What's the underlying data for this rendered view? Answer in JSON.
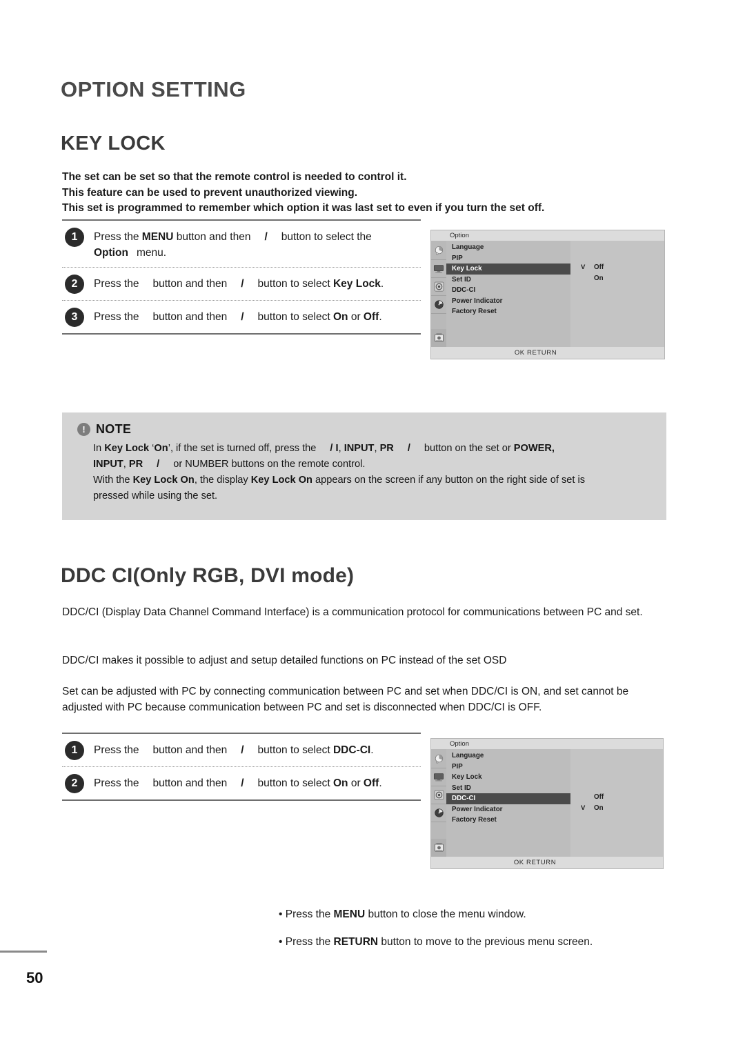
{
  "page": {
    "chapter_title": "OPTION SETTING",
    "page_number": "50"
  },
  "key_lock": {
    "section_title": "KEY LOCK",
    "intro_line1": "The set can be set so that the remote control is needed to control it.",
    "intro_line2": "This feature can be used to prevent unauthorized viewing.",
    "intro_line3": "This set is programmed to remember which option it was last set to even if you turn the set off.",
    "steps": [
      {
        "number": "1",
        "t1": "Press the ",
        "b1": "MENU",
        "t2": " button and then",
        "slash": "/",
        "t3": "button to select the",
        "b2": "Option",
        "t4": "menu."
      },
      {
        "number": "2",
        "t1": "Press the",
        "t2": "button and then",
        "slash": "/",
        "t3": "button to select ",
        "b1": "Key Lock",
        "t4": "."
      },
      {
        "number": "3",
        "t1": "Press the",
        "t2": "button and then",
        "slash": "/",
        "t3": "button to select ",
        "b1": "On",
        "t4": " or ",
        "b2": "Off",
        "t5": "."
      }
    ]
  },
  "osd_keylock": {
    "title": "Option",
    "items": [
      {
        "label": "Language",
        "selected": false
      },
      {
        "label": "PIP",
        "selected": false
      },
      {
        "label": "Key Lock",
        "selected": true
      },
      {
        "label": "Set ID",
        "selected": false
      },
      {
        "label": "DDC-CI",
        "selected": false
      },
      {
        "label": "Power Indicator",
        "selected": false
      },
      {
        "label": "Factory Reset",
        "selected": false
      }
    ],
    "options": [
      {
        "label": "Off",
        "checked": true
      },
      {
        "label": "On",
        "checked": false
      }
    ],
    "check_mark": "V",
    "footer": "OK  RETURN",
    "rail_icons": [
      "picture-icon",
      "screen-icon",
      "audio-icon",
      "time-icon",
      "option-icon"
    ]
  },
  "note": {
    "title": "NOTE",
    "icon": "exclamation-icon",
    "line1_a": "In ",
    "line1_b1": "Key Lock",
    "line1_c": " ‘",
    "line1_b2": "On",
    "line1_d": "’, if the set is turned off, press the",
    "line1_b3": "/ I",
    "line1_e": ", ",
    "line1_b4": "INPUT",
    "line1_f": ", ",
    "line1_b5": "PR",
    "line1_g": "/",
    "line1_h": "button on the set or ",
    "line1_b6": "POWER,",
    "line2_b1": "INPUT",
    "line2_a": ", ",
    "line2_b2": "PR",
    "line2_b": "/",
    "line2_c": "or NUMBER buttons on the remote control.",
    "line3_a": "With the ",
    "line3_b1": "Key Lock On",
    "line3_b": ", the display ",
    "line3_b2": "Key Lock On",
    "line3_c": " appears on the screen if any button on the right side of set is",
    "line4": "pressed while using the set."
  },
  "ddc": {
    "section_title": "DDC CI(Only RGB, DVI mode)",
    "para1": "DDC/CI (Display Data Channel Command Interface) is a communication protocol for communications between PC and set.",
    "para2": "DDC/CI makes it possible to adjust and setup detailed functions on PC instead of the set OSD",
    "para3": "Set can be adjusted with PC by connecting communication between PC and set when DDC/CI is ON, and set cannot be adjusted with PC because communication between PC and set is disconnected when DDC/CI is OFF.",
    "steps": [
      {
        "number": "1",
        "t1": "Press the",
        "t2": "button and then",
        "slash": "/",
        "t3": "button to select ",
        "b1": "DDC-CI",
        "t4": "."
      },
      {
        "number": "2",
        "t1": "Press the",
        "t2": "button and then",
        "slash": "/",
        "t3": "button to select ",
        "b1": "On",
        "t4": " or ",
        "b2": "Off",
        "t5": "."
      }
    ]
  },
  "osd_ddc": {
    "title": "Option",
    "items": [
      {
        "label": "Language",
        "selected": false
      },
      {
        "label": "PIP",
        "selected": false
      },
      {
        "label": "Key Lock",
        "selected": false
      },
      {
        "label": "Set ID",
        "selected": false
      },
      {
        "label": "DDC-CI",
        "selected": true
      },
      {
        "label": "Power Indicator",
        "selected": false
      },
      {
        "label": "Factory Reset",
        "selected": false
      }
    ],
    "options": [
      {
        "label": "Off",
        "checked": false
      },
      {
        "label": "On",
        "checked": true
      }
    ],
    "check_mark": "V",
    "footer": "OK  RETURN",
    "rail_icons": [
      "picture-icon",
      "screen-icon",
      "audio-icon",
      "time-icon",
      "option-icon"
    ]
  },
  "bottom_notes": [
    {
      "a": "• Press the ",
      "b": "MENU",
      "c": " button to close the menu window."
    },
    {
      "a": "• Press the ",
      "b": "RETURN",
      "c": " button to move to the previous menu screen."
    }
  ],
  "colors": {
    "heading_gray": "#4a4a4a",
    "note_bg": "#d4d4d4",
    "osd_bg": "#c9c9c9",
    "osd_selected": "#4b4b4b"
  }
}
